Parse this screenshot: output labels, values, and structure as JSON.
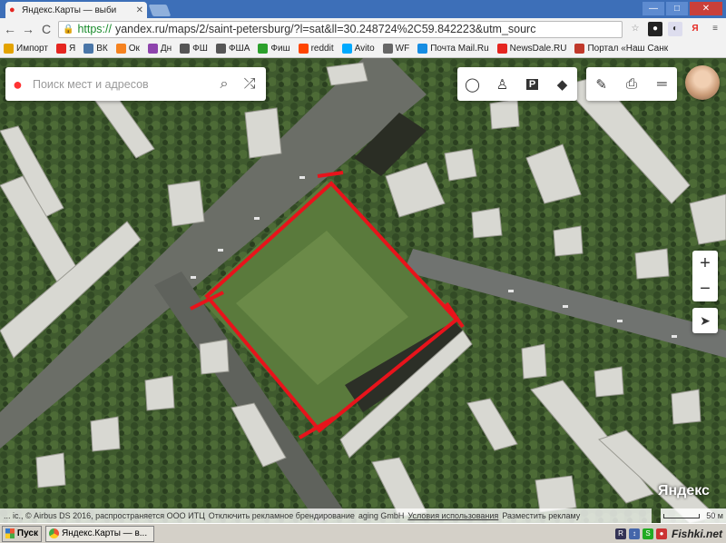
{
  "browser": {
    "tab_title": "Яндекс.Карты — выби",
    "url_scheme": "https://",
    "url_rest": "yandex.ru/maps/2/saint-petersburg/?l=sat&ll=30.248724%2C59.842223&utm_sourc",
    "buttons": {
      "back": "←",
      "forward": "→",
      "reload": "C",
      "minimize": "—",
      "maximize": "□",
      "close": "✕"
    }
  },
  "bookmarks": [
    {
      "label": "Импорт",
      "color": "#e3a300"
    },
    {
      "label": "Я",
      "color": "#e52620"
    },
    {
      "label": "ВК",
      "color": "#4a76a8"
    },
    {
      "label": "Ок",
      "color": "#f58220"
    },
    {
      "label": "Дн",
      "color": "#8e44ad"
    },
    {
      "label": "ФШ",
      "color": "#555555"
    },
    {
      "label": "ФША",
      "color": "#555555"
    },
    {
      "label": "Фиш",
      "color": "#2ca02c"
    },
    {
      "label": "reddit",
      "color": "#ff4500"
    },
    {
      "label": "Avito",
      "color": "#00aaff"
    },
    {
      "label": "WF",
      "color": "#666666"
    },
    {
      "label": "Почта Mail.Ru",
      "color": "#168de2"
    },
    {
      "label": "NewsDale.RU",
      "color": "#e52620"
    },
    {
      "label": "Портал «Наш Санк",
      "color": "#c0392b"
    }
  ],
  "map": {
    "search_placeholder": "Поиск мест и адресов",
    "brand": "Яндекс",
    "attribution": "... іс., © Airbus DS 2016, распространяется ООО ИТЦ",
    "attribution_disable_ads": "Отключить рекламное брендирование",
    "attribution_company": "aging GmbH",
    "attribution_terms": "Условия использования",
    "attribution_ad": "Разместить рекламу",
    "scale_label": "50 м",
    "zoom_in": "+",
    "zoom_out": "−",
    "highlight_color": "#e8131b"
  },
  "taskbar": {
    "start_label": "Пуск",
    "task_label": "Яндекс.Карты — в...",
    "watermark": "Fishki.net"
  }
}
